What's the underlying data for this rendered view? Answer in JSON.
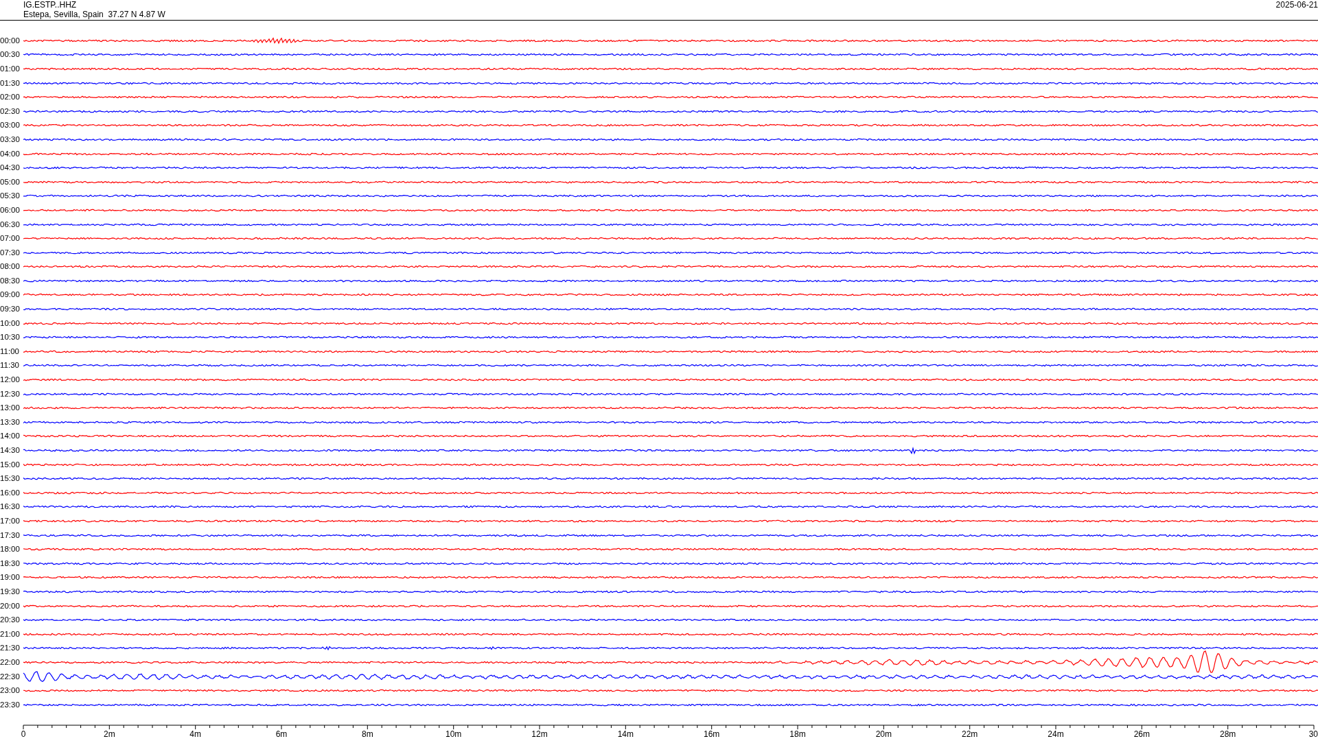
{
  "header": {
    "station": "IG.ESTP..HHZ",
    "location": "Estepa, Sevilla, Spain  37.27 N 4.87 W",
    "date": "2025-06-21"
  },
  "rows": [
    {
      "time": "00:00",
      "color": "#ff0000"
    },
    {
      "time": "00:30",
      "color": "#0000ff"
    },
    {
      "time": "01:00",
      "color": "#ff0000"
    },
    {
      "time": "01:30",
      "color": "#0000ff"
    },
    {
      "time": "02:00",
      "color": "#ff0000"
    },
    {
      "time": "02:30",
      "color": "#0000ff"
    },
    {
      "time": "03:00",
      "color": "#ff0000"
    },
    {
      "time": "03:30",
      "color": "#0000ff"
    },
    {
      "time": "04:00",
      "color": "#ff0000"
    },
    {
      "time": "04:30",
      "color": "#0000ff"
    },
    {
      "time": "05:00",
      "color": "#ff0000"
    },
    {
      "time": "05:30",
      "color": "#0000ff"
    },
    {
      "time": "06:00",
      "color": "#ff0000"
    },
    {
      "time": "06:30",
      "color": "#0000ff"
    },
    {
      "time": "07:00",
      "color": "#ff0000"
    },
    {
      "time": "07:30",
      "color": "#0000ff"
    },
    {
      "time": "08:00",
      "color": "#ff0000"
    },
    {
      "time": "08:30",
      "color": "#0000ff"
    },
    {
      "time": "09:00",
      "color": "#ff0000"
    },
    {
      "time": "09:30",
      "color": "#0000ff"
    },
    {
      "time": "10:00",
      "color": "#ff0000"
    },
    {
      "time": "10:30",
      "color": "#0000ff"
    },
    {
      "time": "11:00",
      "color": "#ff0000"
    },
    {
      "time": "11:30",
      "color": "#0000ff"
    },
    {
      "time": "12:00",
      "color": "#ff0000"
    },
    {
      "time": "12:30",
      "color": "#0000ff"
    },
    {
      "time": "13:00",
      "color": "#ff0000"
    },
    {
      "time": "13:30",
      "color": "#0000ff"
    },
    {
      "time": "14:00",
      "color": "#ff0000"
    },
    {
      "time": "14:30",
      "color": "#0000ff"
    },
    {
      "time": "15:00",
      "color": "#ff0000"
    },
    {
      "time": "15:30",
      "color": "#0000ff"
    },
    {
      "time": "16:00",
      "color": "#ff0000"
    },
    {
      "time": "16:30",
      "color": "#0000ff"
    },
    {
      "time": "17:00",
      "color": "#ff0000"
    },
    {
      "time": "17:30",
      "color": "#0000ff"
    },
    {
      "time": "18:00",
      "color": "#ff0000"
    },
    {
      "time": "18:30",
      "color": "#0000ff"
    },
    {
      "time": "19:00",
      "color": "#ff0000"
    },
    {
      "time": "19:30",
      "color": "#0000ff"
    },
    {
      "time": "20:00",
      "color": "#ff0000"
    },
    {
      "time": "20:30",
      "color": "#0000ff"
    },
    {
      "time": "21:00",
      "color": "#ff0000"
    },
    {
      "time": "21:30",
      "color": "#0000ff"
    },
    {
      "time": "22:00",
      "color": "#ff0000"
    },
    {
      "time": "22:30",
      "color": "#0000ff"
    },
    {
      "time": "23:00",
      "color": "#ff0000"
    },
    {
      "time": "23:30",
      "color": "#0000ff"
    }
  ],
  "axis_labels": [
    "0",
    "2m",
    "4m",
    "6m",
    "8m",
    "10m",
    "12m",
    "14m",
    "16m",
    "18m",
    "20m",
    "22m",
    "24m",
    "26m",
    "28m",
    "30"
  ]
}
